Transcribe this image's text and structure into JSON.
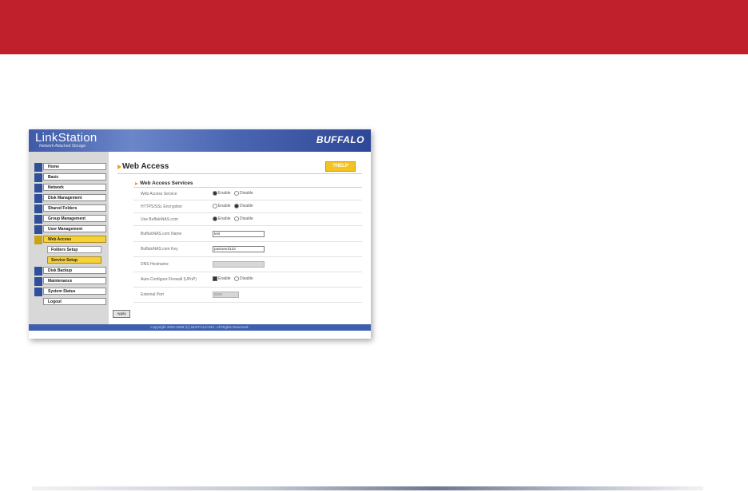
{
  "screenshot": {
    "brand": "LinkStation",
    "brand_subtitle": "Network Attached Storage",
    "maker": "BUFFALO",
    "sidebar": {
      "items": [
        {
          "label": "Home"
        },
        {
          "label": "Basic"
        },
        {
          "label": "Network"
        },
        {
          "label": "Disk Management"
        },
        {
          "label": "Shared Folders"
        },
        {
          "label": "Group Management"
        },
        {
          "label": "User Management"
        },
        {
          "label": "Web Access"
        },
        {
          "label": "Disk Backup"
        },
        {
          "label": "Maintenance"
        },
        {
          "label": "System Status"
        },
        {
          "label": "Logout"
        }
      ],
      "subitems": [
        {
          "label": "Folders Setup"
        },
        {
          "label": "Service Setup"
        }
      ],
      "active_item": "Web Access",
      "active_subitem": "Service Setup"
    },
    "page_title": "Web Access",
    "help_label": "?HELP",
    "section_title": "Web Access Services",
    "rows": {
      "web_access_service": {
        "label": "Web Access Service",
        "enable": "Enable",
        "disable": "Disable",
        "selected": "Enable"
      },
      "https": {
        "label": "HTTPS/SSL Encryption",
        "enable": "Enable",
        "disable": "Disable",
        "selected": "Disable"
      },
      "use_buffalonas": {
        "label": "Use BuffaloNAS.com",
        "enable": "Enable",
        "disable": "Disable",
        "selected": "Enable"
      },
      "buffalonas_name": {
        "label": "BuffaloNAS.com Name",
        "value": "test"
      },
      "buffalonas_key": {
        "label": "BuffaloNAS.com Key",
        "value": "password123"
      },
      "dns_hostname": {
        "label": "DNS Hostname",
        "value": ""
      },
      "upnp": {
        "label": "Auto-Configure Firewall (UPnP)",
        "enable": "Enable",
        "disable": "Disable",
        "selected": "Enable"
      },
      "external_port": {
        "label": "External Port",
        "value": "9000"
      }
    },
    "apply_label": "Apply",
    "footer": "Copyright 2002-2008 (C) BUFFALO INC. All Rights Reserved."
  },
  "colors": {
    "banner": "#c0202c",
    "header_blue": "#4a66b2",
    "active_yellow": "#f5d23a"
  }
}
